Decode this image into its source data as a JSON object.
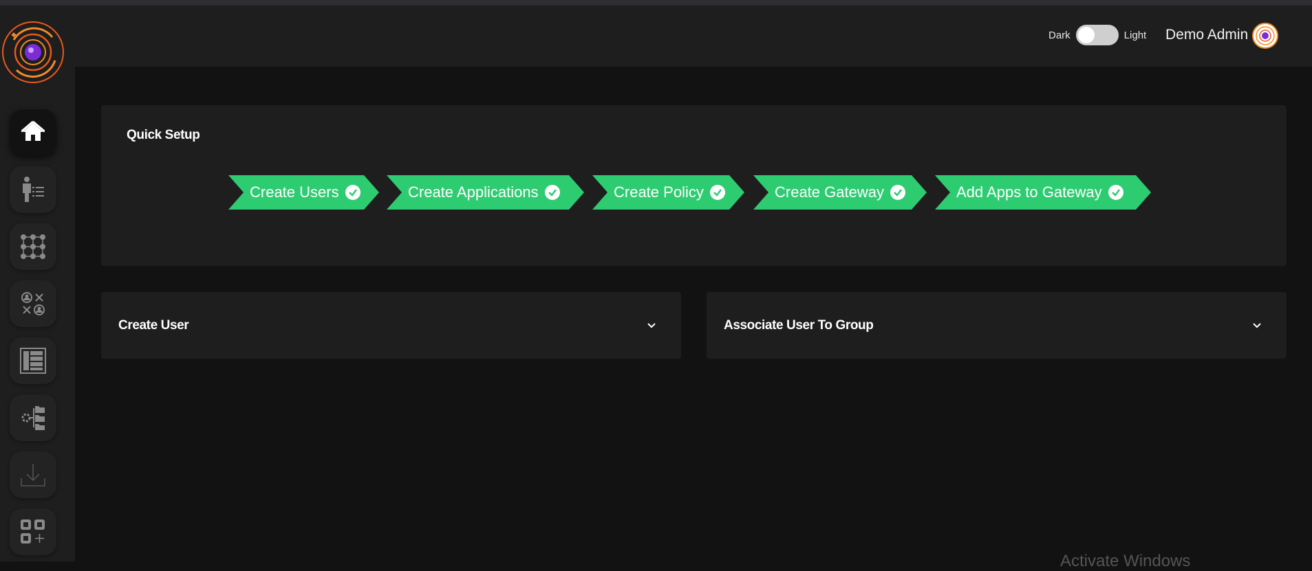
{
  "header": {
    "theme_toggle": {
      "left_label": "Dark",
      "right_label": "Light"
    },
    "user_name": "Demo Admin"
  },
  "sidebar": {
    "items": [
      {
        "icon": "home-icon",
        "active": true
      },
      {
        "icon": "user-list-icon",
        "active": false
      },
      {
        "icon": "grid-dots-icon",
        "active": false
      },
      {
        "icon": "user-network-icon",
        "active": false
      },
      {
        "icon": "layout-panel-icon",
        "active": false
      },
      {
        "icon": "settings-folders-icon",
        "active": false
      },
      {
        "icon": "download-icon",
        "active": false
      },
      {
        "icon": "apps-add-icon",
        "active": false
      }
    ]
  },
  "quick_setup": {
    "title": "Quick Setup",
    "steps": [
      {
        "label": "Create Users",
        "done": true
      },
      {
        "label": "Create Applications",
        "done": true
      },
      {
        "label": "Create Policy",
        "done": true
      },
      {
        "label": "Create Gateway",
        "done": true
      },
      {
        "label": "Add Apps to Gateway",
        "done": true
      }
    ]
  },
  "panels": {
    "create_user": {
      "title": "Create User"
    },
    "associate_user": {
      "title": "Associate User To Group"
    }
  },
  "watermark": "Activate Windows",
  "colors": {
    "accent_green": "#2ecc71",
    "bg": "#121212",
    "panel": "#1e1e1e",
    "brand_orange": "#f28c28",
    "brand_purple": "#7b2cd6"
  }
}
